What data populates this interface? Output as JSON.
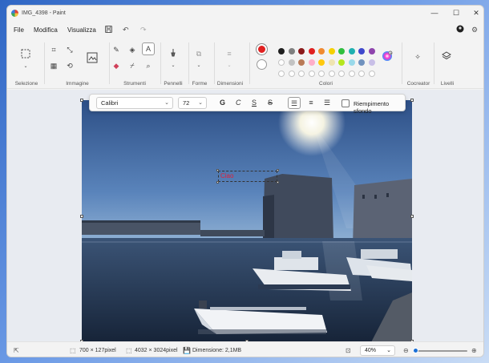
{
  "window": {
    "title": "IMG_4398 - Paint",
    "minimize": "—",
    "maximize": "☐",
    "close": "✕"
  },
  "menu": {
    "file": "File",
    "edit": "Modifica",
    "view": "Visualizza"
  },
  "ribbon": {
    "selection_label": "Selezione",
    "image_label": "Immagine",
    "tools_label": "Strumenti",
    "brushes_label": "Pennelli",
    "shapes_label": "Forme",
    "size_label": "Dimensioni",
    "colors_label": "Colori",
    "cocreator_label": "Cocreator",
    "layers_label": "Livelli",
    "primary_color": "#e02020",
    "secondary_color": "#ffffff",
    "palette_row1": [
      "#1f1f1f",
      "#7f7f7f",
      "#8b1a1a",
      "#e02020",
      "#f08a30",
      "#f5d000",
      "#2fbf3f",
      "#1fb0b0",
      "#3f48cc",
      "#8e44ad"
    ],
    "palette_row2": [
      "#ffffff",
      "#c3c3c3",
      "#b97a57",
      "#ffaec9",
      "#ffc90e",
      "#efe4b0",
      "#b5e61d",
      "#99d9ea",
      "#7092be",
      "#c8bfe7"
    ]
  },
  "textbar": {
    "font": "Calibri",
    "size": "72",
    "bold": "G",
    "italic": "C",
    "underline": "S",
    "strike": "S",
    "fill_label": "Riempimento sfondo"
  },
  "canvas": {
    "text_content": "Ciao",
    "text_color": "#e0203a"
  },
  "status": {
    "selection_size": "700 × 127pixel",
    "image_size": "4032 × 3024pixel",
    "file_size": "Dimensione: 2,1MB",
    "zoom": "40%",
    "zoom_level": 0.4
  }
}
